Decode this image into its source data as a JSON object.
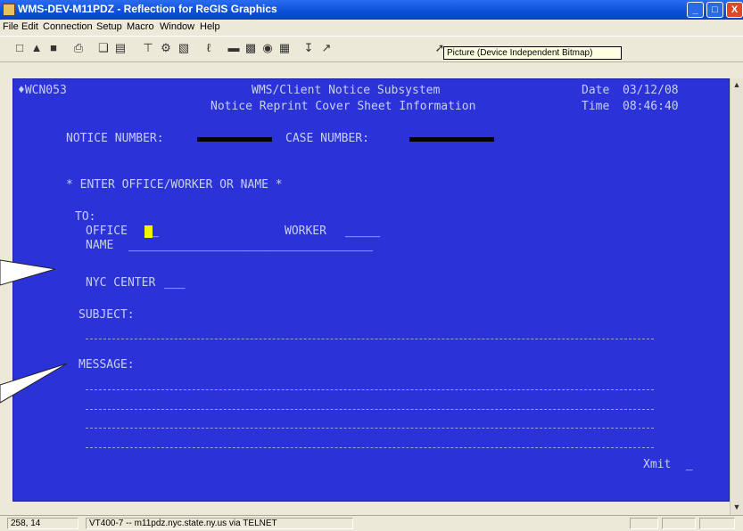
{
  "window": {
    "title": "WMS-DEV-M11PDZ - Reflection for ReGIS Graphics",
    "buttons": {
      "minimize": "_",
      "maximize": "□",
      "close": "X"
    }
  },
  "menu": [
    "File",
    "Edit",
    "Connection",
    "Setup",
    "Macro",
    "Window",
    "Help"
  ],
  "toolbar": {
    "tooltip": "Picture (Device Independent Bitmap)",
    "icons": [
      "new-icon",
      "open-icon",
      "save-icon",
      "print-icon",
      "copy-icon",
      "paste-icon",
      "connect-icon",
      "settings-icon",
      "keyboard-icon",
      "macro-icon",
      "record-icon",
      "transfer-icon",
      "display-icon",
      "help-icon",
      "context-help-icon"
    ]
  },
  "screen": {
    "screen_id": "♦WCN053",
    "system_title": "WMS/Client Notice Subsystem",
    "subtitle": "Notice Reprint Cover Sheet Information",
    "date_label": "Date",
    "date_value": "03/12/08",
    "time_label": "Time",
    "time_value": "08:46:40",
    "notice_number_label": "NOTICE NUMBER:",
    "case_number_label": "CASE NUMBER:",
    "instruction": "* ENTER OFFICE/WORKER OR NAME *",
    "to_label": "TO:",
    "office_label": "OFFICE",
    "office_value": "__",
    "worker_label": "WORKER",
    "worker_value": "_____",
    "name_label": "NAME",
    "name_value": "___________________________________",
    "nyc_center_label": "NYC CENTER",
    "nyc_center_value": "___",
    "subject_label": "SUBJECT:",
    "message_label": "MESSAGE:",
    "xmit_label": "Xmit",
    "xmit_value": "_"
  },
  "status": {
    "cursor_pos": "258, 14",
    "connection": "VT400-7 -- m11pdz.nyc.state.ny.us via TELNET"
  },
  "colors": {
    "terminal_bg": "#2a32d8",
    "terminal_text": "#c8d0f0",
    "cursor": "#f4f100",
    "title_blue": "#0b4fd8"
  }
}
